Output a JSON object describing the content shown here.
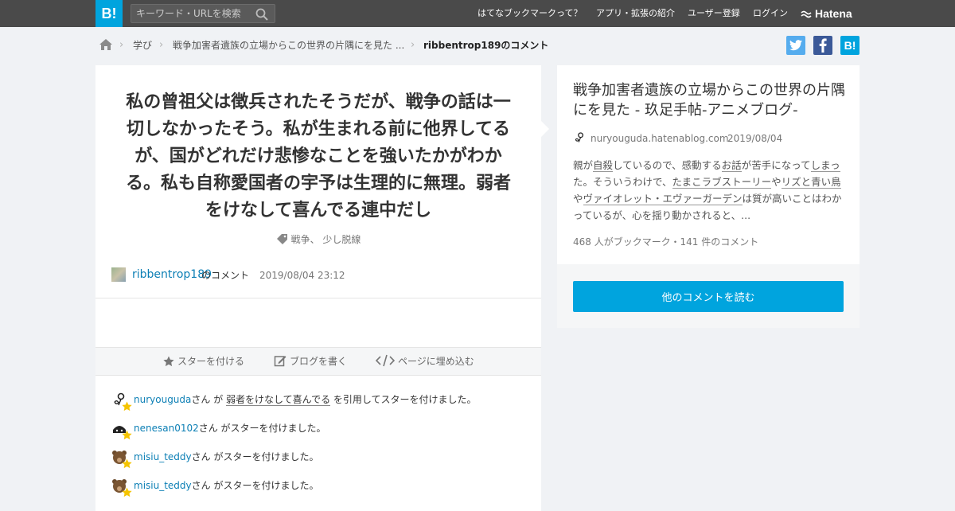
{
  "header": {
    "logo": "B!",
    "search_placeholder": "キーワード・URLを検索",
    "nav": [
      "はてなブックマークって？",
      "アプリ・拡張の紹介",
      "ユーザー登録",
      "ログイン"
    ],
    "brand": "Hatena"
  },
  "breadcrumb": {
    "category": "学び",
    "entry": "戦争加害者遺族の立場からこの世界の片隅にを見た ...",
    "current": "ribbentrop189のコメント"
  },
  "share": {
    "twitter": "t",
    "facebook": "f",
    "hatena": "B!"
  },
  "comment": {
    "text": "私の曾祖父は徴兵されたそうだが、戦争の話は一切しなかったそう。私が生まれる前に他界してるが、国がどれだけ悲惨なことを強いたかがわかる。私も自称愛国者の宇予は生理的に無理。弱者をけなして喜んでる連中だし",
    "tags": "戦争、 少し脱線",
    "user": "ribbentrop189",
    "user_suffix": "のコメント",
    "date": "2019/08/04 23:12"
  },
  "actions": {
    "star": "スターを付ける",
    "blog": "ブログを書く",
    "embed": "ページに埋め込む"
  },
  "stars": [
    {
      "user": "nuryouguda",
      "pre": "さん が ",
      "quote": "弱者をけなして喜んでる",
      "post": " を引用してスターを付けました。"
    },
    {
      "user": "nenesan0102",
      "pre": "さん がスターを付けました。",
      "quote": "",
      "post": ""
    },
    {
      "user": "misiu_teddy",
      "pre": "さん がスターを付けました。",
      "quote": "",
      "post": ""
    },
    {
      "user": "misiu_teddy",
      "pre": "さん がスターを付けました。",
      "quote": "",
      "post": ""
    }
  ],
  "entry": {
    "title": "戦争加害者遺族の立場からこの世界の片隅にを見た - 玖足手帖-アニメブログ-",
    "domain": "nuryouguda.hatenablog.com",
    "date": "2019/08/04",
    "summary": [
      {
        "t": "親が",
        "k": false
      },
      {
        "t": "自殺",
        "k": true
      },
      {
        "t": "しているので、感動する",
        "k": false
      },
      {
        "t": "お話",
        "k": true
      },
      {
        "t": "が苦手になって",
        "k": false
      },
      {
        "t": "しまっ",
        "k": true
      },
      {
        "t": "た。そういうわけで、",
        "k": false
      },
      {
        "t": "たまこラブストーリー",
        "k": true
      },
      {
        "t": "や",
        "k": false
      },
      {
        "t": "リズと青い鳥",
        "k": true
      },
      {
        "t": "や",
        "k": false
      },
      {
        "t": "ヴァイオレット・エヴァーガーデン",
        "k": true
      },
      {
        "t": "は質が高いことはわかっているが、心を揺り動かされると、...",
        "k": false
      }
    ],
    "counts": "468 人がブックマーク・141 件のコメント"
  },
  "read_button": "他のコメントを読む",
  "colors": {
    "accent": "#00a4de",
    "header": "#4a4a4a",
    "link": "#0c7fb5",
    "star": "#f5c400"
  }
}
